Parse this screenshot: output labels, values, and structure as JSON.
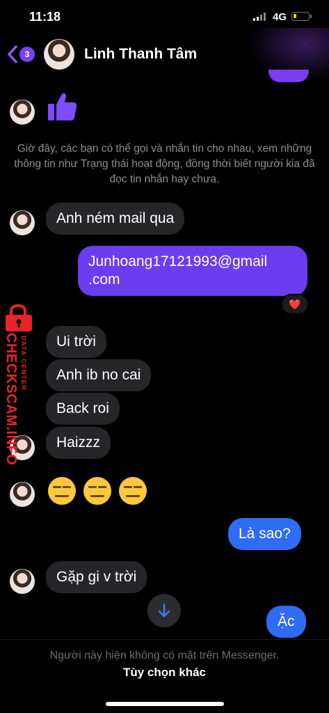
{
  "status_bar": {
    "time": "11:18",
    "network": "4G"
  },
  "header": {
    "back_badge_count": "3",
    "contact_name": "Linh Thanh Tâm"
  },
  "info_text": "Giờ đây, các bạn có thể gọi và nhắn tin cho nhau, xem những thông tin như Trạng thái hoạt động, đồng thời biết người kia đã đọc tin nhắn hay chưa.",
  "messages": {
    "m1": "Anh ném mail qua",
    "m2": "Junhoang17121993@gmail\n.com",
    "m3": "Ui trời",
    "m4": "Anh ib no cai",
    "m5": "Back roi",
    "m6": "Haizzz",
    "m7": "Là sao?",
    "m8": "Gặp gi v trời",
    "m9": "Ặc"
  },
  "reaction": "❤️",
  "footer": {
    "offline_text": "Người này hiện không có mặt trên Messenger.",
    "more_options": "Tùy chọn khác"
  },
  "watermark": {
    "brand": "CHECKSCAM.INFO",
    "sub": "DATA CENTER"
  },
  "colors": {
    "purple": "#6a3df0",
    "blue": "#2f6cf5",
    "incoming": "#262628",
    "watermark": "#e8232b"
  }
}
